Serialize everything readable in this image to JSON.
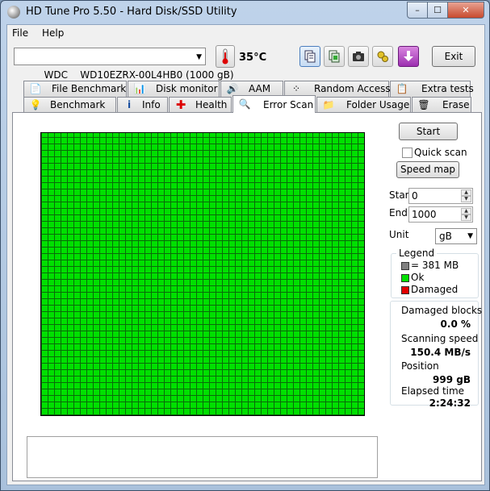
{
  "window": {
    "title": "HD Tune Pro 5.50 - Hard Disk/SSD Utility",
    "min_label": "–",
    "max_label": "☐",
    "close_label": "✕"
  },
  "menu": {
    "file": "File",
    "help": "Help"
  },
  "toolbar": {
    "drive": "WDC    WD10EZRX-00L4HB0 (1000 gB)",
    "temperature": "35°C",
    "exit_label": "Exit",
    "icons": [
      "copy-text-icon",
      "copy-screenshot-icon",
      "camera-icon",
      "options-icon",
      "download-icon"
    ]
  },
  "tabs": {
    "row1": [
      "File Benchmark",
      "Disk monitor",
      "AAM",
      "Random Access",
      "Extra tests"
    ],
    "row2": [
      "Benchmark",
      "Info",
      "Health",
      "Error Scan",
      "Folder Usage",
      "Erase"
    ],
    "active": "Error Scan"
  },
  "scan": {
    "start_button": "Start",
    "quick_scan_label": "Quick scan",
    "quick_scan_checked": false,
    "speed_map_button": "Speed map",
    "start_label": "Start",
    "start_value": "0",
    "end_label": "End",
    "end_value": "1000",
    "unit_label": "Unit",
    "unit_value": "gB",
    "block_status": "ok"
  },
  "legend": {
    "title": "Legend",
    "block_label": "= 381 MB",
    "ok_label": "Ok",
    "damaged_label": "Damaged",
    "ok_color": "#00e000",
    "damaged_color": "#e00000",
    "block_color": "#808080"
  },
  "stats": {
    "damaged_blocks_label": "Damaged blocks",
    "damaged_blocks_value": "0.0 %",
    "scanning_speed_label": "Scanning speed",
    "scanning_speed_value": "150.4 MB/s",
    "position_label": "Position",
    "position_value": "999 gB",
    "elapsed_label": "Elapsed time",
    "elapsed_value": "2:24:32"
  }
}
